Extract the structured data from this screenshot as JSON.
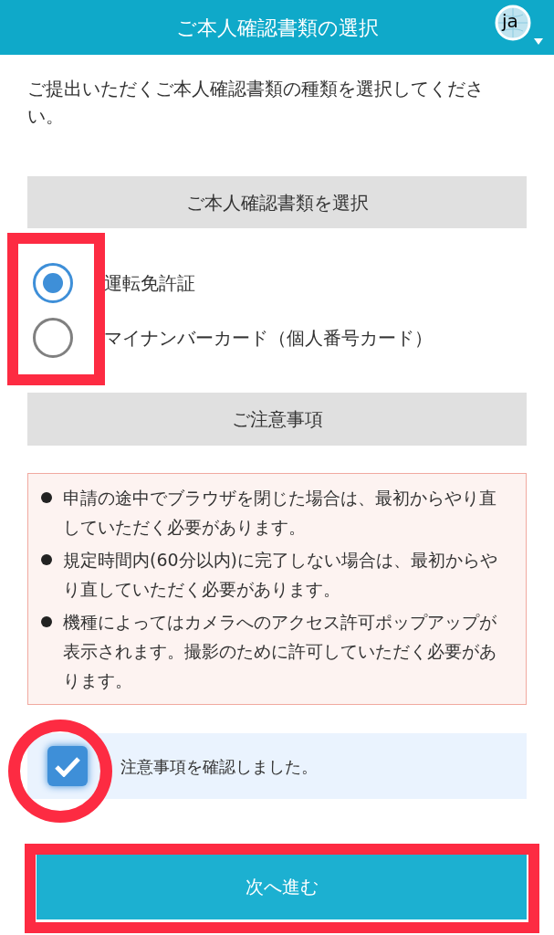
{
  "header": {
    "title": "ご本人確認書類の選択",
    "language": "ja"
  },
  "intro": "ご提出いただくご本人確認書類の種類を選択してください。",
  "document_section": {
    "heading": "ご本人確認書類を選択",
    "options": [
      {
        "label": "運転免許証",
        "selected": true
      },
      {
        "label": "マイナンバーカード（個人番号カード）",
        "selected": false
      }
    ]
  },
  "notes_section": {
    "heading": "ご注意事項",
    "notes": [
      "申請の途中でブラウザを閉じた場合は、最初からやり直していただく必要があります。",
      "規定時間内(60分以内)に完了しない場合は、最初からやり直していただく必要があります。",
      "機種によってはカメラへのアクセス許可ポップアップが表示されます。撮影のために許可していただく必要があります。"
    ]
  },
  "confirm": {
    "label": "注意事項を確認しました。",
    "checked": true
  },
  "button": "次へ進む"
}
